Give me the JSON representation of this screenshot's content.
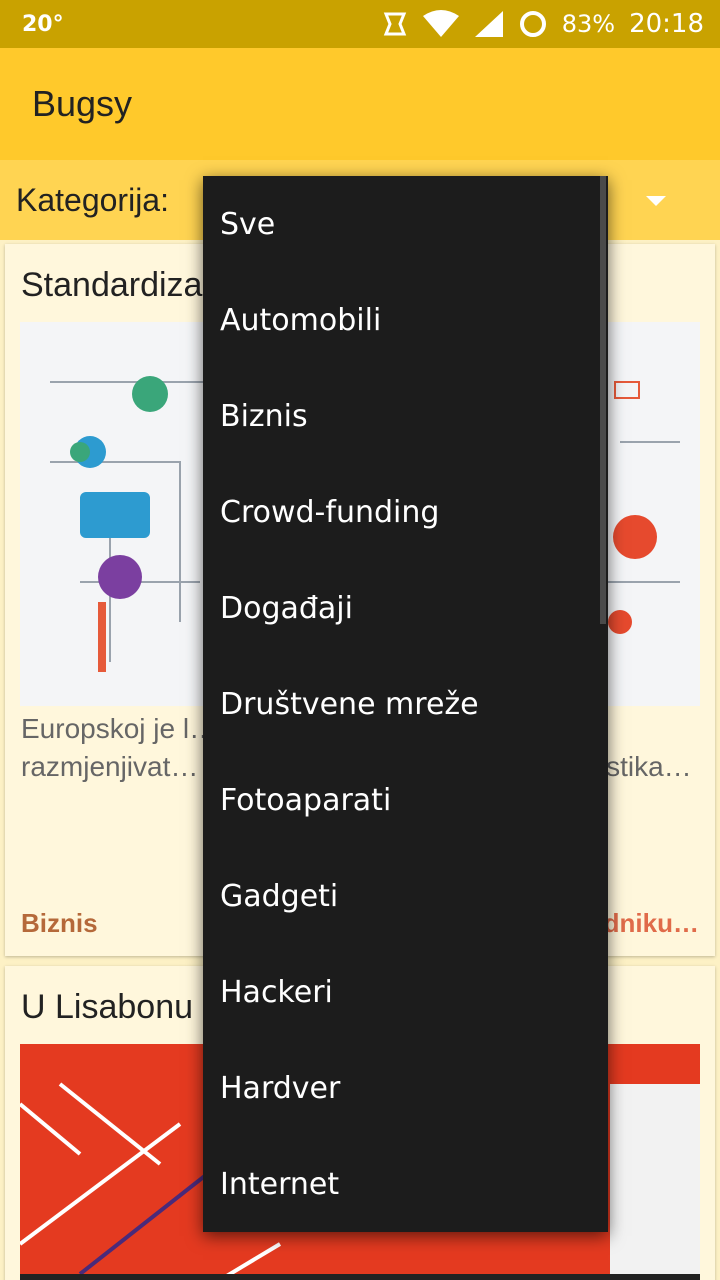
{
  "status_bar": {
    "temperature": "20°",
    "battery_percent": "83%",
    "time": "20:18"
  },
  "app_bar": {
    "title": "Bugsy"
  },
  "filter": {
    "label": "Kategorija:"
  },
  "articles": [
    {
      "title": "Standardiza…eno…",
      "excerpt": "Europskoj je l… i uređaji u bud… vezati i razmjenjivat… ođaču, operacijskom… karakteristika…",
      "category": "Biznis",
      "read_more": "edniku…"
    },
    {
      "title": "U Lisabonu … imp…"
    }
  ],
  "dropdown": {
    "options": [
      "Sve",
      "Automobili",
      "Biznis",
      "Crowd-funding",
      "Događaji",
      "Društvene mreže",
      "Fotoaparati",
      "Gadgeti",
      "Hackeri",
      "Hardver",
      "Internet"
    ]
  },
  "colors": {
    "status_bar": "#c9a200",
    "app_bar": "#ffc92b",
    "filter_row": "#ffd452",
    "card_bg": "#fff7dc",
    "dropdown_bg": "#1c1c1c",
    "category": "#b5693a",
    "read_more": "#e06b4a"
  }
}
